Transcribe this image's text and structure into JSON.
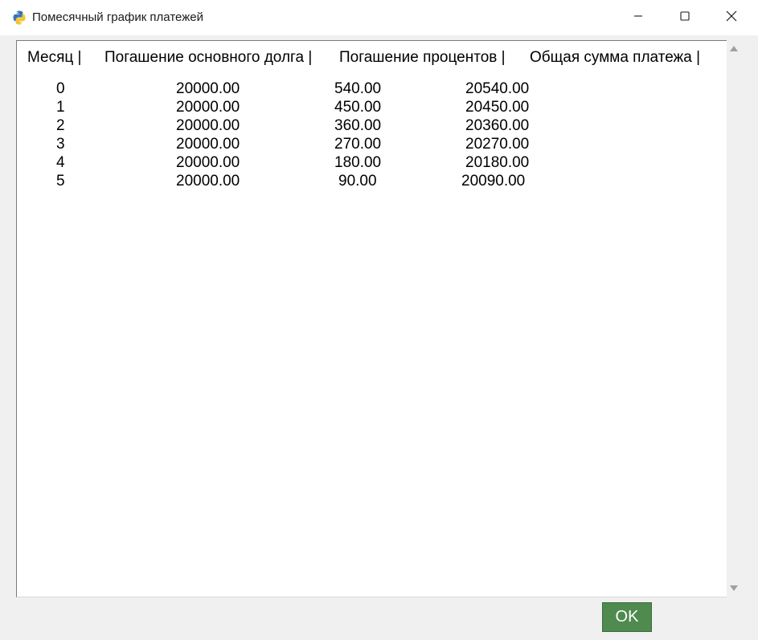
{
  "window": {
    "title": "Помесячный график платежей",
    "icon": "python-icon",
    "controls": {
      "minimize": "minimize-icon",
      "maximize": "maximize-icon",
      "close": "close-icon"
    }
  },
  "table": {
    "headers": {
      "month": "Месяц |",
      "principal": "Погашение основного долга |",
      "interest": "Погашение процентов |",
      "total": "Общая сумма платежа |"
    },
    "rows": [
      {
        "month": "0",
        "principal": "20000.00",
        "interest": "540.00",
        "total": "20540.00"
      },
      {
        "month": "1",
        "principal": "20000.00",
        "interest": "450.00",
        "total": "20450.00"
      },
      {
        "month": "2",
        "principal": "20000.00",
        "interest": "360.00",
        "total": "20360.00"
      },
      {
        "month": "3",
        "principal": "20000.00",
        "interest": "270.00",
        "total": "20270.00"
      },
      {
        "month": "4",
        "principal": "20000.00",
        "interest": "180.00",
        "total": "20180.00"
      },
      {
        "month": "5",
        "principal": "20000.00",
        "interest": "90.00",
        "total": "20090.00"
      }
    ]
  },
  "ok_button": {
    "label": "OK",
    "color": "#4f8a4f"
  }
}
